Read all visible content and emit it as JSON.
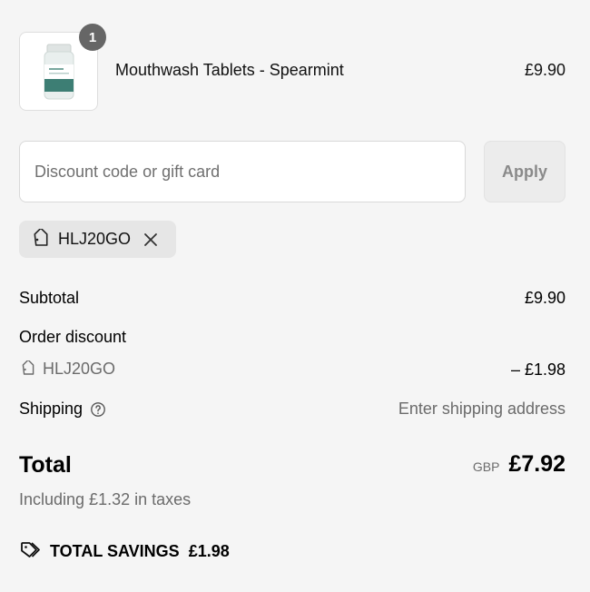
{
  "product": {
    "name": "Mouthwash Tablets - Spearmint",
    "price": "£9.90",
    "quantity": "1",
    "image_icon": "jar-icon"
  },
  "discount": {
    "placeholder": "Discount code or gift card",
    "value": "",
    "apply_label": "Apply",
    "applied_code": "HLJ20GO"
  },
  "summary": {
    "subtotal_label": "Subtotal",
    "subtotal_value": "£9.90",
    "order_discount_label": "Order discount",
    "order_discount_code": "HLJ20GO",
    "order_discount_value": "– £1.98",
    "shipping_label": "Shipping",
    "shipping_value": "Enter shipping address",
    "total_label": "Total",
    "currency": "GBP",
    "total_value": "£7.92",
    "taxes_note": "Including £1.32 in taxes",
    "savings_label": "TOTAL SAVINGS",
    "savings_value": "£1.98"
  },
  "colors": {
    "background": "#f5f5f5",
    "badge": "#666666",
    "muted_text": "#6b6b6b"
  }
}
